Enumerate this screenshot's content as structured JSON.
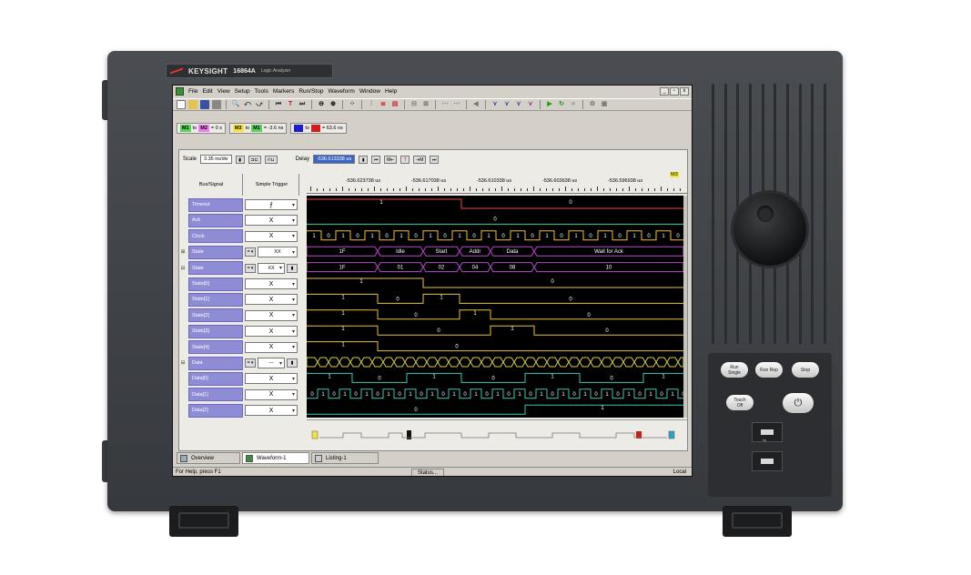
{
  "device": {
    "brand": "KEYSIGHT",
    "model": "16864A",
    "model_subtitle": "Logic Analyzer",
    "hard_buttons": [
      {
        "line1": "Run",
        "line2": "Single"
      },
      {
        "line1": "Run Rep",
        "line2": ""
      },
      {
        "line1": "Stop",
        "line2": ""
      },
      {
        "line1": "Touch",
        "line2": "Off"
      }
    ]
  },
  "window": {
    "menus": [
      "File",
      "Edit",
      "View",
      "Setup",
      "Tools",
      "Markers",
      "Run/Stop",
      "Waveform",
      "Window",
      "Help"
    ],
    "controls": [
      "_",
      "▫",
      "x"
    ]
  },
  "markers": {
    "m1_to_m2": {
      "a": "M1",
      "to": "to",
      "b": "M2",
      "value": "= 0 s"
    },
    "m3_to_m1": {
      "a": "M3",
      "to": "to",
      "b": "M1",
      "value": "= -3.6 ns"
    },
    "blue_to_red": {
      "to": "to",
      "value": "= 63.6 ns"
    },
    "colors": {
      "M1": "#57d357",
      "M2": "#f07cf0",
      "M3": "#f3e33c",
      "blue": "#1b1bd6",
      "red": "#d61b1b"
    }
  },
  "scale": {
    "label": "Scale",
    "value": "3.35 ns/div",
    "delay_label": "Delay",
    "delay_value": "-536.613338 us"
  },
  "columns": {
    "bus_signal": "Bus/Signal",
    "simple_trigger": "Simple Trigger"
  },
  "ruler": {
    "labels": [
      "-536.623738 us",
      "-536.617038 us",
      "-536.610338 us",
      "-536.603638 us",
      "-536.596938 us"
    ],
    "marker_flag": "M3"
  },
  "signals": [
    {
      "name": "Timeout",
      "expand": "",
      "trigger": "⨍",
      "kind": "edge"
    },
    {
      "name": "Ack",
      "expand": "",
      "trigger": "X",
      "kind": "x"
    },
    {
      "name": "Clock",
      "expand": "",
      "trigger": "X",
      "kind": "x"
    },
    {
      "name": "State",
      "expand": "⊞",
      "trigger": "XX",
      "kind": "bus"
    },
    {
      "name": "State",
      "expand": "⊟",
      "trigger": "XX",
      "kind": "bus2"
    },
    {
      "name": "State[0]",
      "expand": "",
      "trigger": "X",
      "kind": "x"
    },
    {
      "name": "State[1]",
      "expand": "",
      "trigger": "X",
      "kind": "x"
    },
    {
      "name": "State[2]",
      "expand": "",
      "trigger": "X",
      "kind": "x"
    },
    {
      "name": "State[3]",
      "expand": "",
      "trigger": "X",
      "kind": "x"
    },
    {
      "name": "State[4]",
      "expand": "",
      "trigger": "X",
      "kind": "x"
    },
    {
      "name": "Data",
      "expand": "⊟",
      "trigger": "---",
      "kind": "bus2"
    },
    {
      "name": "Data[0]",
      "expand": "",
      "trigger": "X",
      "kind": "x"
    },
    {
      "name": "Data[1]",
      "expand": "",
      "trigger": "X",
      "kind": "x"
    },
    {
      "name": "Data[2]",
      "expand": "",
      "trigger": "X",
      "kind": "x"
    }
  ],
  "waves": {
    "timeout": {
      "low_label": "1",
      "high_label": "0"
    },
    "ack_label": "0",
    "clock_bits": [
      "1",
      "0",
      "1",
      "0",
      "1",
      "0",
      "1",
      "0",
      "1",
      "0",
      "1",
      "0",
      "1",
      "0",
      "1",
      "0",
      "1",
      "0",
      "1",
      "0",
      "1",
      "0",
      "1",
      "0",
      "1",
      "0"
    ],
    "state_names": [
      "1F",
      "Idle",
      "Start",
      "Addr",
      "Data",
      "Wait for Ack"
    ],
    "state_values": [
      "1F",
      "01",
      "02",
      "04",
      "08",
      "10"
    ],
    "state0": [
      "1",
      "0"
    ],
    "state1": [
      "1",
      "0",
      "1",
      "0"
    ],
    "state2": [
      "1",
      "0",
      "1",
      "0"
    ],
    "state3": [
      "1",
      "0",
      "1",
      "0"
    ],
    "state4": [
      "1",
      "0"
    ],
    "data0": [
      "1",
      "0",
      "1",
      "0",
      "1",
      "0",
      "1"
    ],
    "data1_bits": [
      "0",
      "1",
      "0",
      "1",
      "0",
      "1",
      "0",
      "1",
      "0",
      "1",
      "0",
      "1",
      "0",
      "1",
      "0",
      "1",
      "0",
      "1",
      "0",
      "1",
      "0",
      "1",
      "0",
      "1",
      "0",
      "1",
      "0",
      "1",
      "0",
      "1",
      "0",
      "1",
      "0",
      "1",
      "0"
    ],
    "data2": [
      "0",
      "1"
    ]
  },
  "tabs": [
    "Overview",
    "Waveform-1",
    "Listing-1"
  ],
  "status": {
    "left": "For Help, press F1",
    "middle": "Status...",
    "right": "Local"
  }
}
